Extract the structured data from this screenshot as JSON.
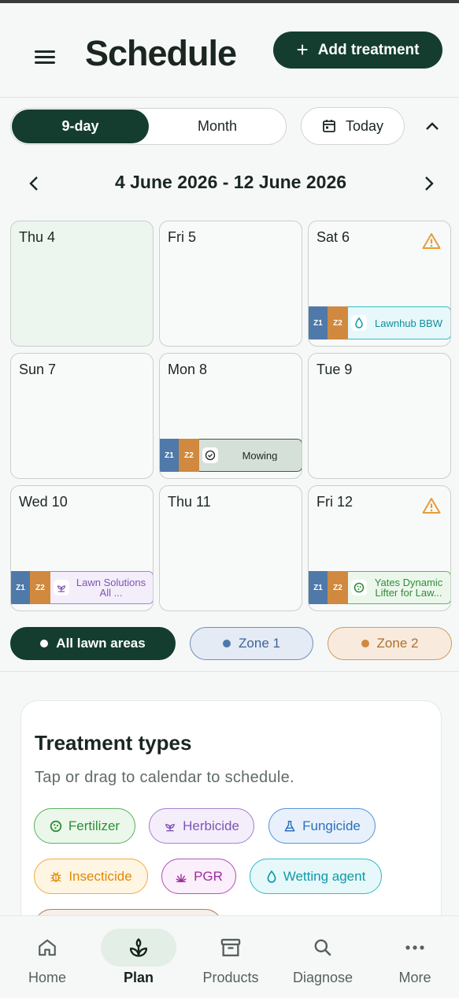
{
  "header": {
    "title": "Schedule",
    "add_button_label": "Add treatment"
  },
  "view": {
    "options": [
      "9-day",
      "Month"
    ],
    "selected": "9-day",
    "today_label": "Today"
  },
  "range": {
    "label": "4 June 2026 - 12 June 2026"
  },
  "days": [
    {
      "label": "Thu 4",
      "today": true
    },
    {
      "label": "Fri 5"
    },
    {
      "label": "Sat 6",
      "warning": true,
      "event": {
        "zones": [
          "Z1",
          "Z2"
        ],
        "text": "Lawnhub BBW",
        "type": "wetting-agent"
      }
    },
    {
      "label": "Sun 7"
    },
    {
      "label": "Mon 8",
      "event": {
        "zones": [
          "Z1",
          "Z2"
        ],
        "text": "Mowing",
        "type": "mowing"
      }
    },
    {
      "label": "Tue 9"
    },
    {
      "label": "Wed 10",
      "event": {
        "zones": [
          "Z1",
          "Z2"
        ],
        "text": "Lawn Solutions All ...",
        "type": "herbicide"
      }
    },
    {
      "label": "Thu 11"
    },
    {
      "label": "Fri 12",
      "warning": true,
      "event": {
        "zones": [
          "Z1",
          "Z2"
        ],
        "text": "Yates Dynamic Lifter for Law...",
        "type": "fertilizer"
      }
    }
  ],
  "zones": {
    "all_label": "All lawn areas",
    "zone1_label": "Zone 1",
    "zone2_label": "Zone 2",
    "zone1_color": "#4f79a9",
    "zone2_color": "#d0893f"
  },
  "treatment_types": {
    "title": "Treatment types",
    "subtitle": "Tap or drag to calendar to schedule.",
    "items": [
      {
        "label": "Fertilizer",
        "icon": "fertilizer-icon"
      },
      {
        "label": "Herbicide",
        "icon": "herbicide-icon"
      },
      {
        "label": "Fungicide",
        "icon": "fungicide-icon"
      },
      {
        "label": "Insecticide",
        "icon": "insecticide-icon"
      },
      {
        "label": "PGR",
        "icon": "pgr-icon"
      },
      {
        "label": "Wetting agent",
        "icon": "wetting-agent-icon"
      }
    ]
  },
  "bottom_nav": {
    "items": [
      {
        "label": "Home",
        "icon": "home-icon"
      },
      {
        "label": "Plan",
        "icon": "plant-icon",
        "active": true
      },
      {
        "label": "Products",
        "icon": "archive-box-icon"
      },
      {
        "label": "Diagnose",
        "icon": "search-icon"
      },
      {
        "label": "More",
        "icon": "more-dots-icon"
      }
    ]
  },
  "colors": {
    "primary": "#143d30",
    "warning": "#e79b3a"
  }
}
